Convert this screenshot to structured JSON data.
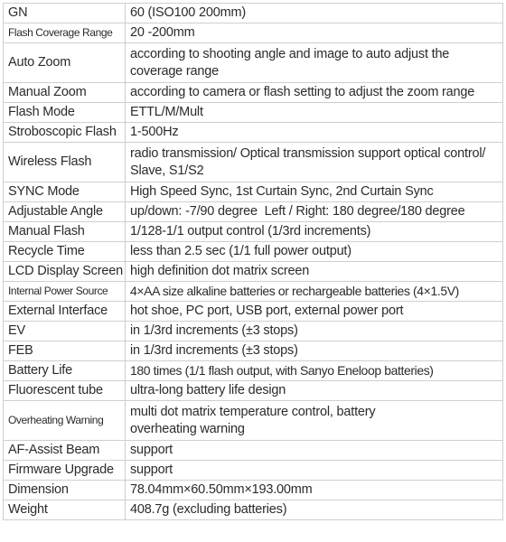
{
  "specs": [
    {
      "label": "GN",
      "value": "60 (ISO100 200mm)"
    },
    {
      "label": "Flash Coverage Range",
      "value": "20 -200mm"
    },
    {
      "label": "Auto Zoom",
      "value": "according to shooting angle and image to auto adjust the coverage range"
    },
    {
      "label": "Manual Zoom",
      "value": "according to camera or flash setting to adjust the zoom range"
    },
    {
      "label": "Flash Mode",
      "value": "ETTL/M/Mult"
    },
    {
      "label": "Stroboscopic Flash",
      "value": "1-500Hz"
    },
    {
      "label": "Wireless Flash",
      "value": "radio transmission/ Optical transmission support optical control/ Slave, S1/S2"
    },
    {
      "label": "SYNC Mode",
      "value": "High Speed Sync, 1st Curtain Sync, 2nd Curtain Sync"
    },
    {
      "label": "Adjustable Angle",
      "value": "up/down: -7/90 degree  Left / Right: 180 degree/180 degree"
    },
    {
      "label": "Manual Flash",
      "value": "1/128-1/1 output control (1/3rd increments)"
    },
    {
      "label": "Recycle Time",
      "value": "less than 2.5 sec (1/1 full power output)"
    },
    {
      "label": "LCD Display Screen",
      "value": "high definition dot matrix screen"
    },
    {
      "label": "Internal Power Source",
      "value": "4×AA size alkaline batteries or rechargeable batteries (4×1.5V)"
    },
    {
      "label": "External Interface",
      "value": "hot shoe, PC port, USB port, external power port"
    },
    {
      "label": "EV",
      "value": "in 1/3rd increments (±3 stops)"
    },
    {
      "label": "FEB",
      "value": "in 1/3rd increments (±3 stops)"
    },
    {
      "label": "Battery Life",
      "value": "180 times (1/1 flash output, with Sanyo Eneloop batteries)"
    },
    {
      "label": "Fluorescent tube",
      "value": "ultra-long battery life design"
    },
    {
      "label": "Overheating Warning",
      "value": "multi dot matrix temperature control, battery overheating warning"
    },
    {
      "label": "AF-Assist Beam",
      "value": "support"
    },
    {
      "label": "Firmware Upgrade",
      "value": "support"
    },
    {
      "label": "Dimension",
      "value": "78.04mm×60.50mm×193.00mm"
    },
    {
      "label": "Weight",
      "value": "408.7g (excluding batteries)"
    }
  ]
}
